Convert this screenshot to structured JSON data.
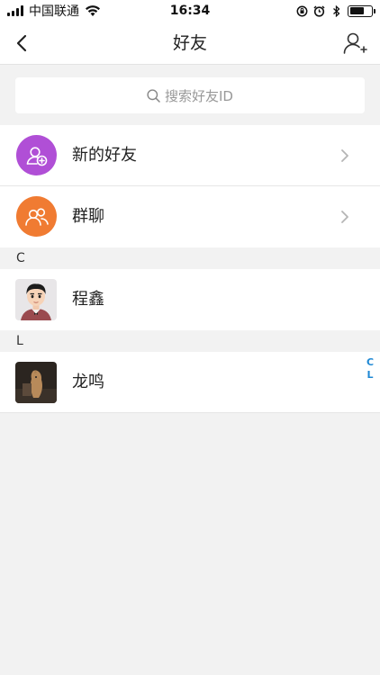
{
  "status_bar": {
    "carrier": "中国联通",
    "time": "16:34"
  },
  "nav": {
    "title": "好友",
    "back_icon": "chevron-left-icon",
    "add_icon": "add-user-icon"
  },
  "search": {
    "placeholder": "搜索好友ID"
  },
  "entries": [
    {
      "label": "新的好友",
      "icon": "new-friend-icon",
      "color": "#b04fd6"
    },
    {
      "label": "群聊",
      "icon": "group-chat-icon",
      "color": "#f07b32"
    }
  ],
  "sections": [
    {
      "letter": "C",
      "contacts": [
        {
          "name": "程鑫"
        }
      ]
    },
    {
      "letter": "L",
      "contacts": [
        {
          "name": "龙鸣"
        }
      ]
    }
  ],
  "index": [
    "C",
    "L"
  ]
}
